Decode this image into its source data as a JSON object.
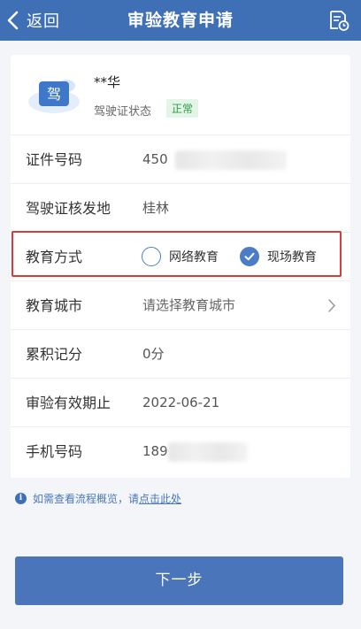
{
  "nav": {
    "back_label": "返回",
    "title": "审验教育申请",
    "right_icon": "document-clock-icon"
  },
  "profile": {
    "avatar_glyph": "驾",
    "name": "**华",
    "status_label": "驾驶证状态",
    "status_value": "正常"
  },
  "rows": {
    "id_number": {
      "label": "证件号码",
      "value": "450"
    },
    "issue_place": {
      "label": "驾驶证核发地",
      "value": "桂林"
    },
    "edu_mode": {
      "label": "教育方式",
      "options": [
        {
          "label": "网络教育",
          "checked": false
        },
        {
          "label": "现场教育",
          "checked": true
        }
      ]
    },
    "edu_city": {
      "label": "教育城市",
      "placeholder": "请选择教育城市"
    },
    "points": {
      "label": "累积记分",
      "value": "0分"
    },
    "expiry": {
      "label": "审验有效期止",
      "value": "2022-06-21"
    },
    "phone": {
      "label": "手机号码",
      "value": "189"
    }
  },
  "info": {
    "text": "如需查看流程概览，请",
    "link": "点击此处"
  },
  "next_button": "下一步",
  "colors": {
    "nav_bg": "#3f6fb5",
    "accent": "#4a7cc8",
    "highlight": "#d93a3a",
    "status_green": "#2f9b48"
  }
}
